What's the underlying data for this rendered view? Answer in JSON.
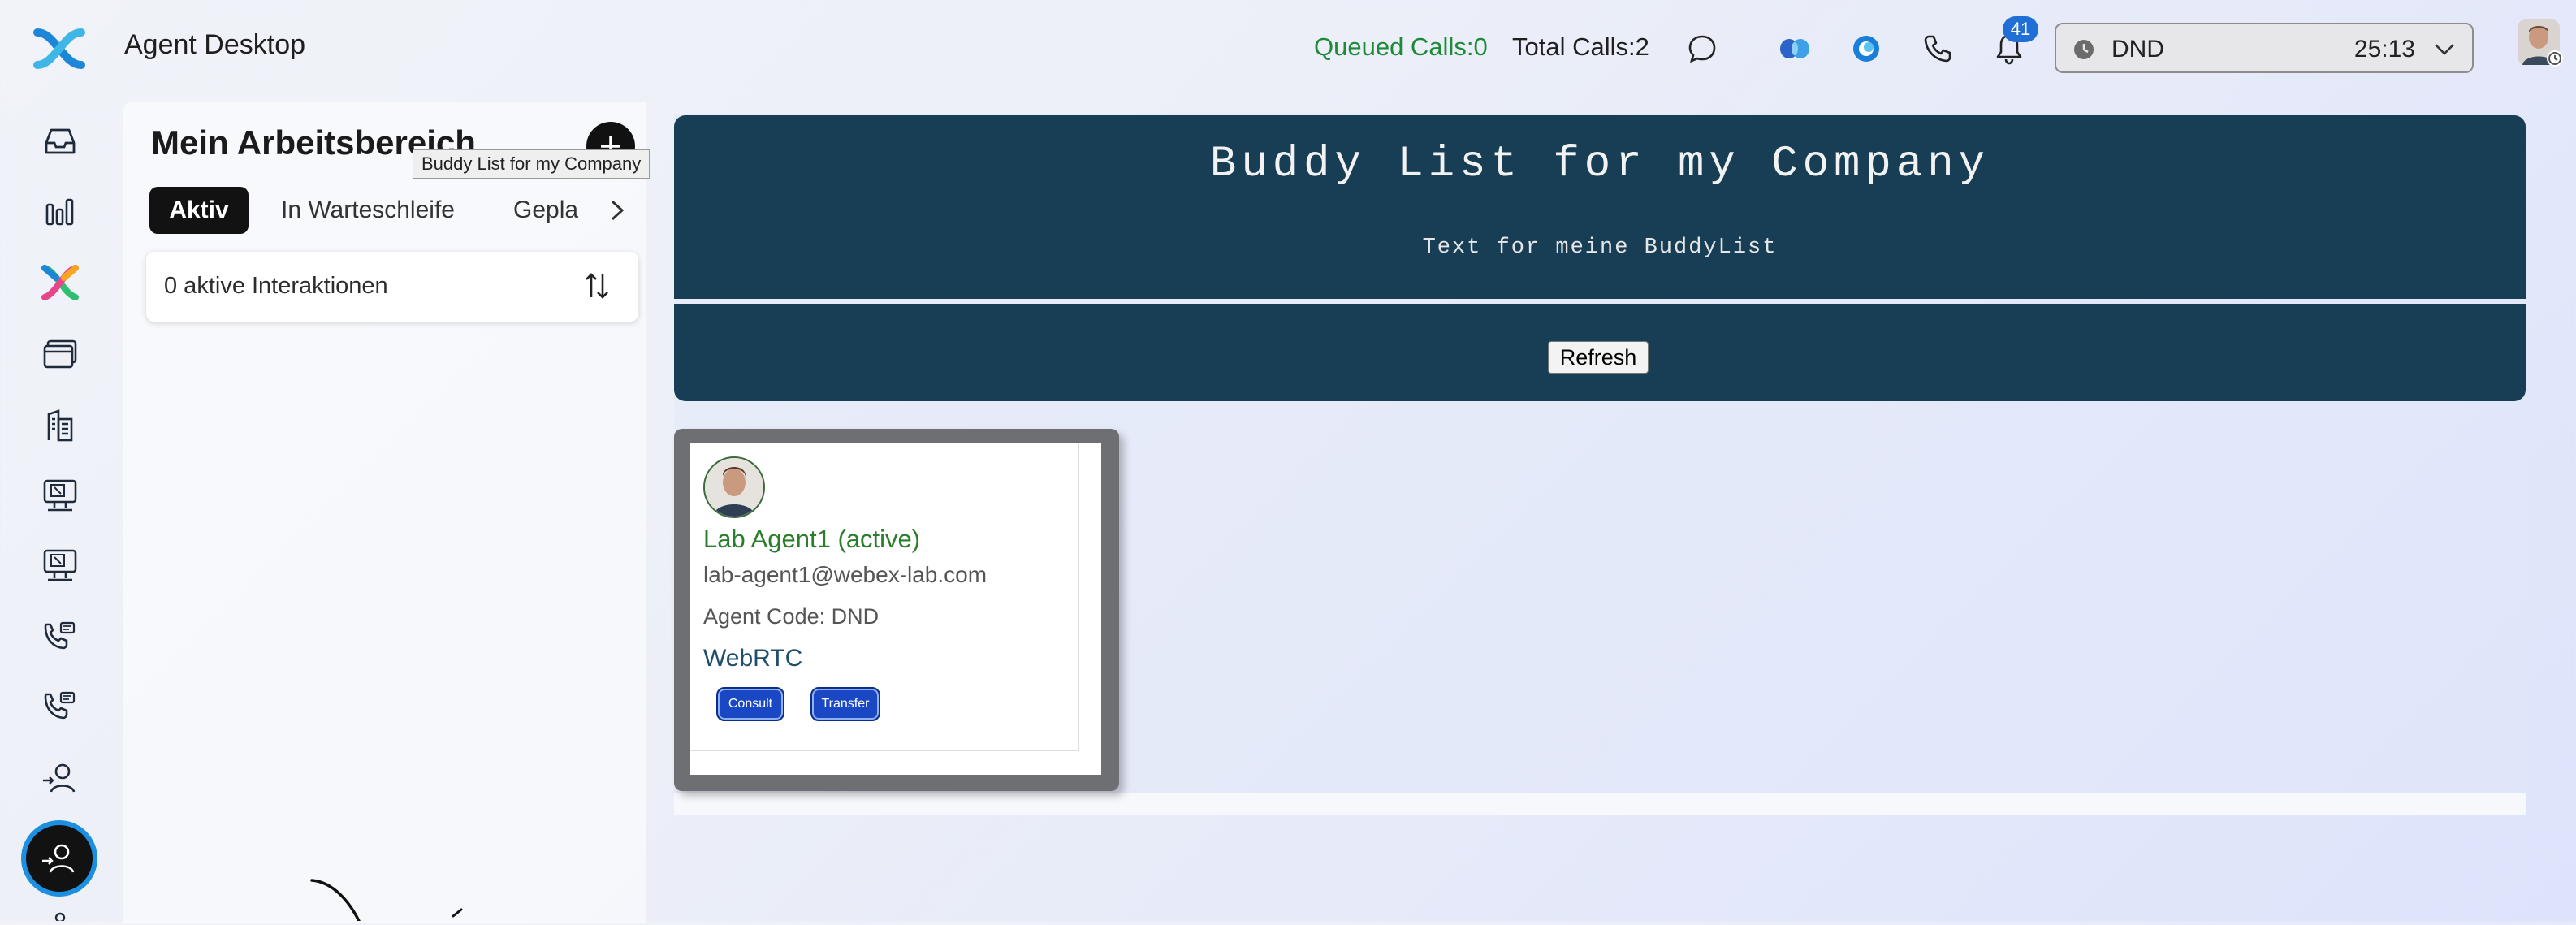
{
  "header": {
    "app_title": "Agent Desktop",
    "queued_calls": "Queued Calls:0",
    "total_calls": "Total Calls:2",
    "notification_count": "41",
    "state": {
      "label": "DND",
      "timer": "25:13"
    }
  },
  "nav": {
    "items": [
      "inbox-icon",
      "analytics-icon",
      "webex-app-icon",
      "browser-window-icon",
      "building-icon",
      "monitor-tool-icon",
      "monitor-tool-icon",
      "phone-video-icon",
      "phone-video-icon",
      "agent-transfer-icon",
      "agent-person-icon"
    ],
    "active_item": "agent-person-icon"
  },
  "workspace": {
    "title": "Mein Arbeitsbereich",
    "tooltip": "Buddy List for my Company",
    "tabs": {
      "active": "Aktiv",
      "hold": "In Warteschleife",
      "planned": "Gepla"
    },
    "interactions_text": "0 aktive Interaktionen"
  },
  "buddy_list": {
    "title": "Buddy List for my Company",
    "subtitle": "Text for meine BuddyList",
    "refresh_label": "Refresh",
    "buddies": [
      {
        "name": "Lab Agent1 (active)",
        "email": "lab-agent1@webex-lab.com",
        "agent_code": "Agent Code: DND",
        "device": "WebRTC",
        "consult_label": "Consult",
        "transfer_label": "Transfer"
      }
    ]
  },
  "colors": {
    "banner_bg": "#173e54",
    "queued_green": "#1d8a3a",
    "active_agent_green": "#2a7d2a",
    "action_button_blue": "#1a48c4",
    "badge_blue": "#1f6fd6",
    "nav_active_ring": "#1c8fe0"
  }
}
